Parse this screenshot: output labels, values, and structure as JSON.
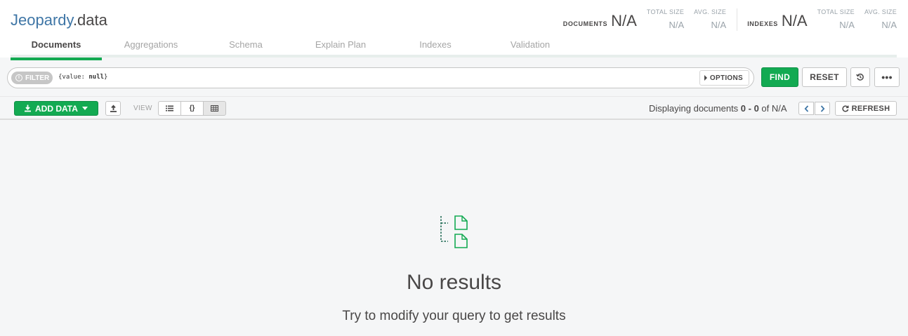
{
  "header": {
    "db_name": "Jeopardy",
    "collection_name": ".data",
    "documents_label": "DOCUMENTS",
    "documents_value": "N/A",
    "doc_total_size_label": "TOTAL SIZE",
    "doc_total_size_value": "N/A",
    "doc_avg_size_label": "AVG. SIZE",
    "doc_avg_size_value": "N/A",
    "indexes_label": "INDEXES",
    "indexes_value": "N/A",
    "idx_total_size_label": "TOTAL SIZE",
    "idx_total_size_value": "N/A",
    "idx_avg_size_label": "AVG. SIZE",
    "idx_avg_size_value": "N/A"
  },
  "tabs": [
    {
      "label": "Documents",
      "active": true
    },
    {
      "label": "Aggregations",
      "active": false
    },
    {
      "label": "Schema",
      "active": false
    },
    {
      "label": "Explain Plan",
      "active": false
    },
    {
      "label": "Indexes",
      "active": false
    },
    {
      "label": "Validation",
      "active": false
    }
  ],
  "filter": {
    "pill_label": "FILTER",
    "query_open": "{value: ",
    "query_keyword": "null",
    "query_close": "}",
    "options_label": "OPTIONS",
    "find_label": "FIND",
    "reset_label": "RESET",
    "more_label": "•••"
  },
  "toolbar": {
    "add_data_label": "ADD DATA",
    "view_label": "VIEW",
    "view_json_label": "{}",
    "displaying_prefix": "Displaying documents ",
    "displaying_range": "0 - 0",
    "displaying_suffix": " of N/A",
    "refresh_label": "REFRESH"
  },
  "empty_state": {
    "title": "No results",
    "subtitle": "Try to modify your query to get results"
  },
  "colors": {
    "accent_green": "#13aa52",
    "db_blue": "#3f76a6",
    "text": "#494747",
    "muted": "#9aa3aa"
  },
  "icons": {
    "upload": "upload-icon",
    "history": "history-icon",
    "list_view": "list-view-icon",
    "table_view": "table-view-icon",
    "refresh": "refresh-icon",
    "empty": "documents-empty-icon"
  }
}
